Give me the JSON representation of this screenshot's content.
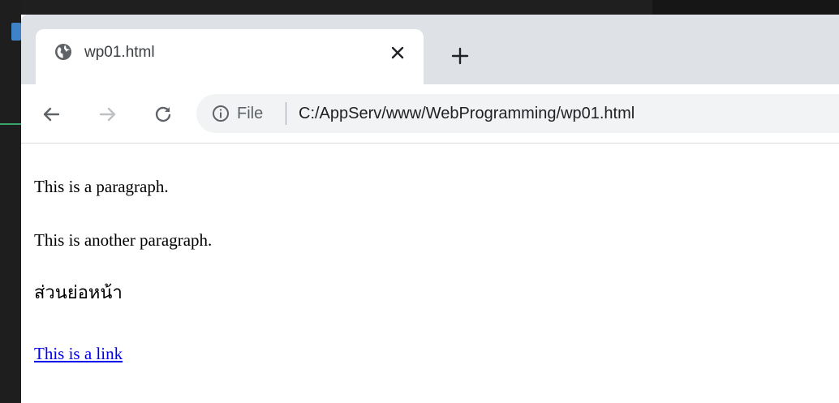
{
  "tab": {
    "title": "wp01.html",
    "favicon_icon": "globe-icon",
    "close_icon": "close-icon"
  },
  "toolbar": {
    "new_tab_icon": "plus-icon",
    "back_icon": "arrow-left-icon",
    "forward_icon": "arrow-right-icon",
    "reload_icon": "reload-icon"
  },
  "omnibox": {
    "info_icon": "info-icon",
    "scheme": "File",
    "url": "C:/AppServ/www/WebProgramming/wp01.html"
  },
  "page": {
    "paragraph_1": "This is a paragraph.",
    "paragraph_2": "This is another paragraph.",
    "paragraph_3": "ส่วนย่อหน้า",
    "link_text": "This is a link",
    "link_color": "#0000ee"
  }
}
